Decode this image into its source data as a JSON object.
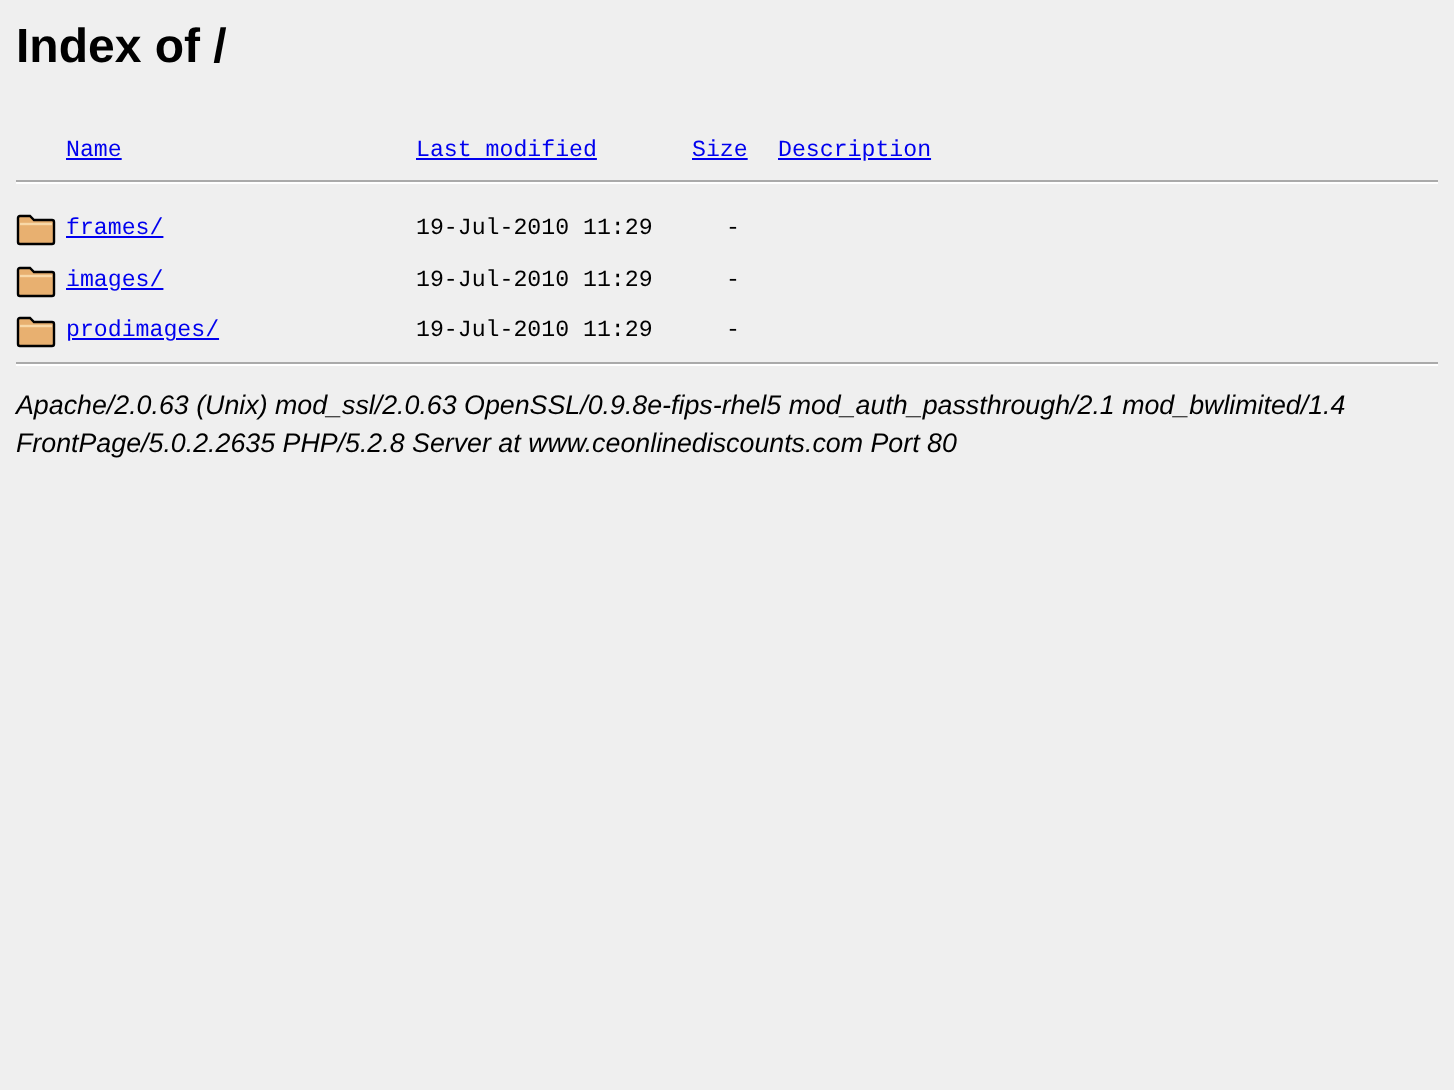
{
  "title": "Index of /",
  "columns": [
    "Name",
    "Last modified",
    "Size",
    "Description"
  ],
  "rows": [
    {
      "kind": "folder",
      "name": "frames/",
      "modified": "19-Jul-2010 11:29",
      "size": "-"
    },
    {
      "kind": "folder",
      "name": "images/",
      "modified": "19-Jul-2010 11:29",
      "size": "-"
    },
    {
      "kind": "folder",
      "name": "prodimages/",
      "modified": "19-Jul-2010 11:29",
      "size": "-"
    }
  ],
  "address": [
    "Apache/2.0.63 (Unix) mod_ssl/2.0.63 OpenSSL/0.9.8e-fips-rhel5 mod_auth_passthrough/2.1 mod_bwlimited/1.4",
    "FrontPage/5.0.2.2635 PHP/5.2.8 Server at www.ceonlinediscounts.com Port 80"
  ]
}
